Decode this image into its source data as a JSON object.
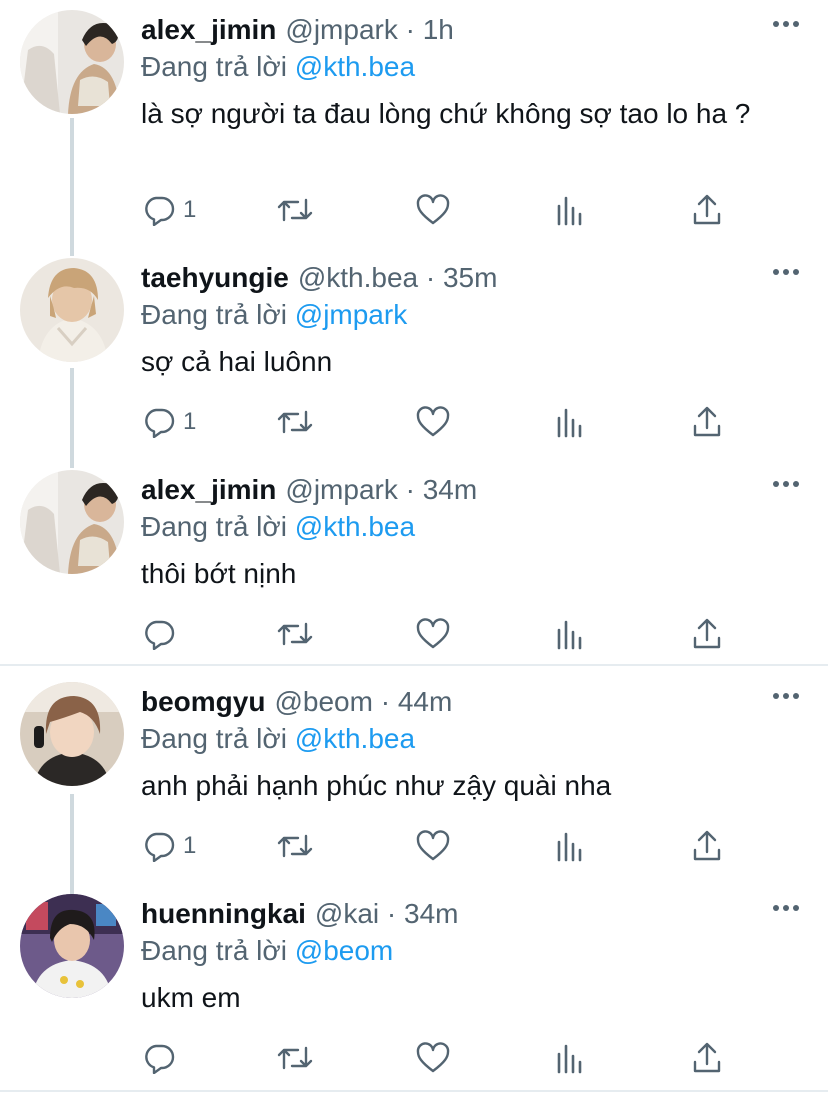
{
  "colors": {
    "text": "#0f1419",
    "secondary": "#536471",
    "accent": "#1d9bf0",
    "thread_line": "#cfd9de",
    "divider": "#e6ecf0"
  },
  "icons": [
    "reply-icon",
    "retweet-icon",
    "like-icon",
    "analytics-icon",
    "share-icon",
    "more-icon"
  ],
  "reply_prefix": "Đang trả lời",
  "tweets": [
    {
      "name": "alex_jimin",
      "handle": "@jmpark",
      "time": "1h",
      "reply_to": "@kth.bea",
      "text": "là sợ người ta đau lòng chứ không sợ tao lo ha ?",
      "reply_count": "1"
    },
    {
      "name": "taehyungie",
      "handle": "@kth.bea",
      "time": "35m",
      "reply_to": "@jmpark",
      "text": "sợ cả hai luônn",
      "reply_count": "1"
    },
    {
      "name": "alex_jimin",
      "handle": "@jmpark",
      "time": "34m",
      "reply_to": "@kth.bea",
      "text": "thôi bớt nịnh",
      "reply_count": ""
    },
    {
      "name": "beomgyu",
      "handle": "@beom",
      "time": "44m",
      "reply_to": "@kth.bea",
      "text": "anh phải hạnh phúc như zậy quài nha",
      "reply_count": "1"
    },
    {
      "name": "huenningkai",
      "handle": "@kai",
      "time": "34m",
      "reply_to": "@beom",
      "text": "ukm em",
      "reply_count": ""
    }
  ]
}
